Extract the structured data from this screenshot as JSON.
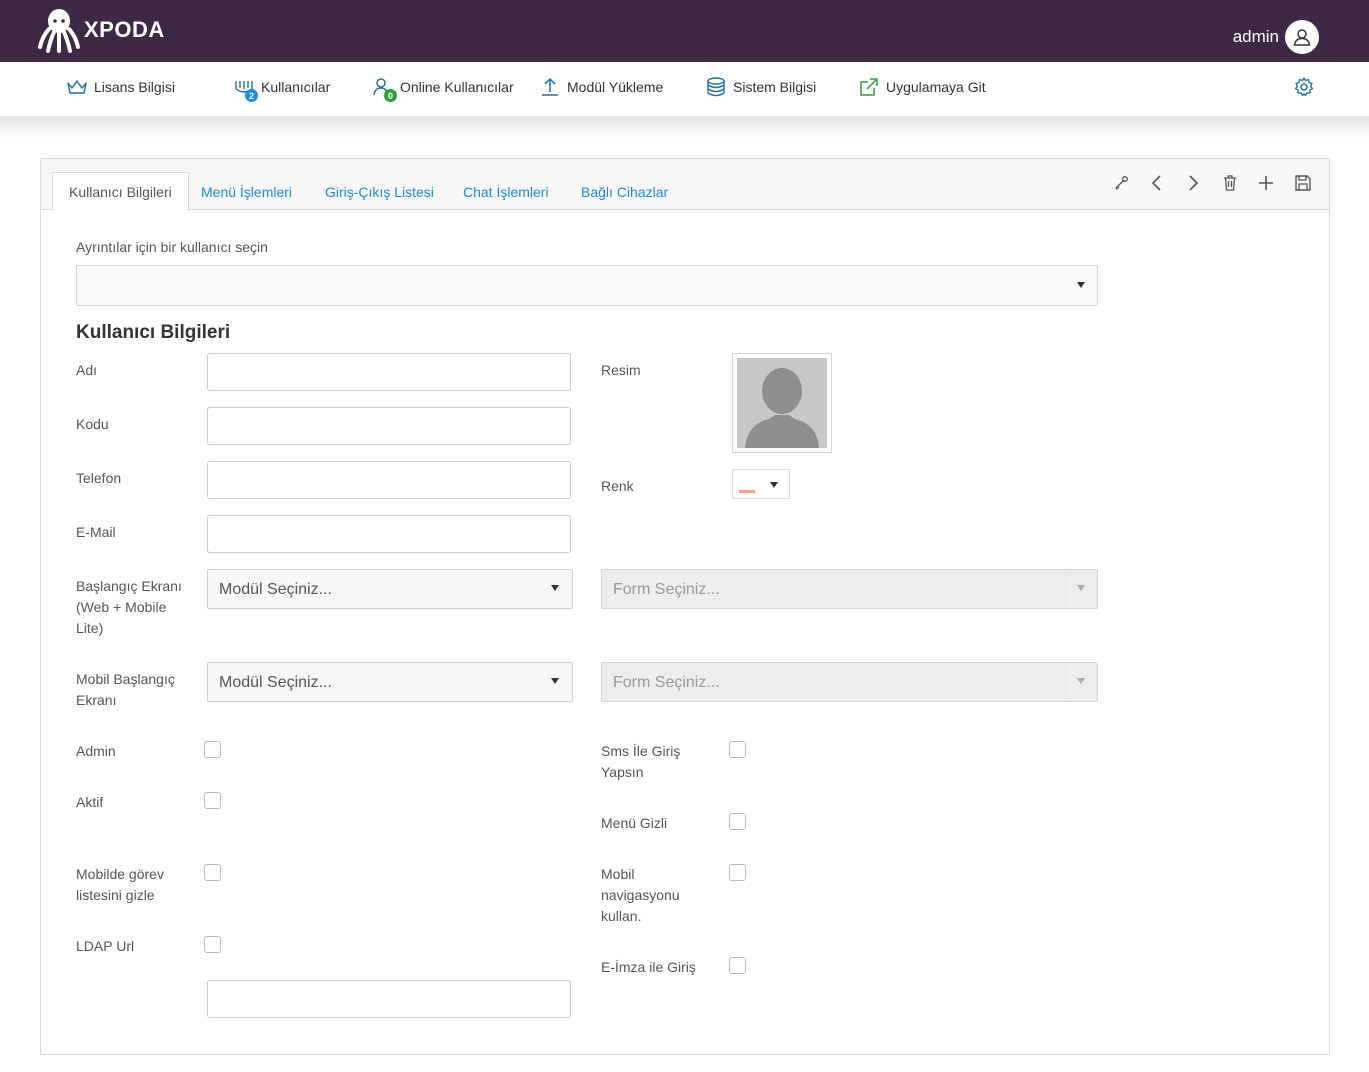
{
  "brand": {
    "name": "XPODA"
  },
  "user": {
    "name": "admin"
  },
  "nav": {
    "items": [
      {
        "label": "Lisans Bilgisi"
      },
      {
        "label": "Kullanıcılar",
        "badge": "2"
      },
      {
        "label": "Online Kullanıcılar",
        "badge": "0"
      },
      {
        "label": "Modül Yükleme"
      },
      {
        "label": "Sistem Bilgisi"
      },
      {
        "label": "Uygulamaya Git"
      }
    ]
  },
  "tabs": [
    {
      "label": "Kullanıcı Bilgileri",
      "active": true
    },
    {
      "label": "Menü İşlemleri"
    },
    {
      "label": "Giriş-Çıkış Listesi"
    },
    {
      "label": "Chat İşlemleri"
    },
    {
      "label": "Bağlı Cihazlar"
    }
  ],
  "toolbar": [
    "key-icon",
    "chevron-left-icon",
    "chevron-right-icon",
    "trash-icon",
    "plus-icon",
    "save-icon"
  ],
  "form": {
    "select_user_label": "Ayrıntılar için bir kullanıcı seçin",
    "select_user_value": "",
    "section_title": "Kullanıcı Bilgileri",
    "fields": {
      "adi": {
        "label": "Adı",
        "value": ""
      },
      "kodu": {
        "label": "Kodu",
        "value": ""
      },
      "telefon": {
        "label": "Telefon",
        "value": ""
      },
      "email": {
        "label": "E-Mail",
        "value": ""
      },
      "ldap_url": {
        "label": "LDAP Url",
        "value": ""
      }
    },
    "resim": {
      "label": "Resim"
    },
    "renk": {
      "label": "Renk"
    },
    "start_screen": {
      "label": "Başlangıç Ekranı (Web + Mobile Lite)",
      "module_placeholder": "Modül Seçiniz...",
      "form_placeholder": "Form Seçiniz..."
    },
    "mobile_start_screen": {
      "label": "Mobil Başlangıç Ekranı",
      "module_placeholder": "Modül Seçiniz...",
      "form_placeholder": "Form Seçiniz..."
    },
    "checkboxes": {
      "admin": {
        "label": "Admin",
        "checked": false
      },
      "aktif": {
        "label": "Aktif",
        "checked": false
      },
      "hide_tasks": {
        "label": "Mobilde görev listesini gizle",
        "checked": false
      },
      "ldap": {
        "label": "LDAP Url",
        "checked": false
      },
      "sms_login": {
        "label": "Sms İle Giriş Yapsın",
        "checked": false
      },
      "menu_hidden": {
        "label": "Menü Gizli",
        "checked": false
      },
      "mobile_nav": {
        "label": "Mobil navigasyonu kullan.",
        "checked": false
      },
      "e_signature": {
        "label": "E-İmza ile Giriş",
        "checked": false
      }
    }
  },
  "colors": {
    "topbar": "#3f2846",
    "link": "#1e88e5",
    "badge_blue": "#1e88e5",
    "badge_green": "#2e9d3a",
    "renk_swatch": "#f0a090"
  }
}
